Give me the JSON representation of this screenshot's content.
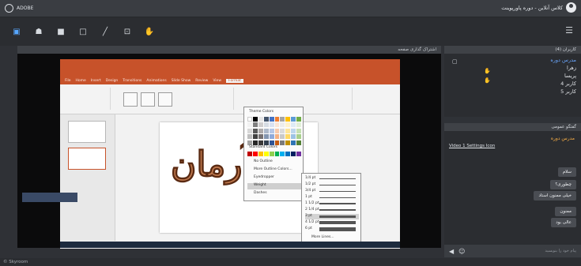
{
  "app": {
    "brand": "ADOBE",
    "room_title": "کلاس آنلاین - دوره پاورپوینت",
    "footer": "© Skyroom"
  },
  "toolbar": {
    "tools": [
      "share-screen-icon",
      "user-icon",
      "camera-icon",
      "whiteboard-icon",
      "pen-icon",
      "file-icon",
      "hand-icon"
    ],
    "menu_icon": "hamburger-icon"
  },
  "stage": {
    "header": "اشتراک گذاری صفحه"
  },
  "ppt": {
    "tabs": [
      "File",
      "Home",
      "Insert",
      "Design",
      "Transitions",
      "Animations",
      "Slide Show",
      "Review",
      "View",
      "Format"
    ],
    "art_text": "آرمان",
    "popup_items": [
      "Theme Colors",
      "Standard Colors",
      "No Outline",
      "More Outline Colors...",
      "Eyedropper",
      "Weight",
      "Dashes"
    ],
    "weights": [
      "1/4 pt",
      "1/2 pt",
      "3/4 pt",
      "1 pt",
      "1 1/2 pt",
      "2 1/4 pt",
      "3 pt",
      "4 1/2 pt",
      "6 pt",
      "More Lines..."
    ]
  },
  "users_panel": {
    "title": "کاربران (4)",
    "users": [
      {
        "name": "مدرس دوره",
        "color": "blue"
      },
      {
        "name": "زهرا",
        "color": "white"
      },
      {
        "name": "پریسا",
        "color": "white"
      },
      {
        "name": "کاربر 4",
        "color": "white"
      },
      {
        "name": "کاربر 5",
        "color": "white"
      }
    ]
  },
  "chat_panel": {
    "title": "گفتگو عمومی",
    "sender": "مدرس دوره",
    "link": "Video 1 Settings Icon",
    "messages": [
      "سلام",
      "چطوری؟",
      "خیلی ممنون استاد",
      "ممنون",
      "عالی بود"
    ],
    "input_placeholder": "پیام خود را بنویسید"
  },
  "colors": {
    "accent": "#57a7ff",
    "ppt_orange": "#c7522a",
    "chat_sender": "#ffb347"
  }
}
